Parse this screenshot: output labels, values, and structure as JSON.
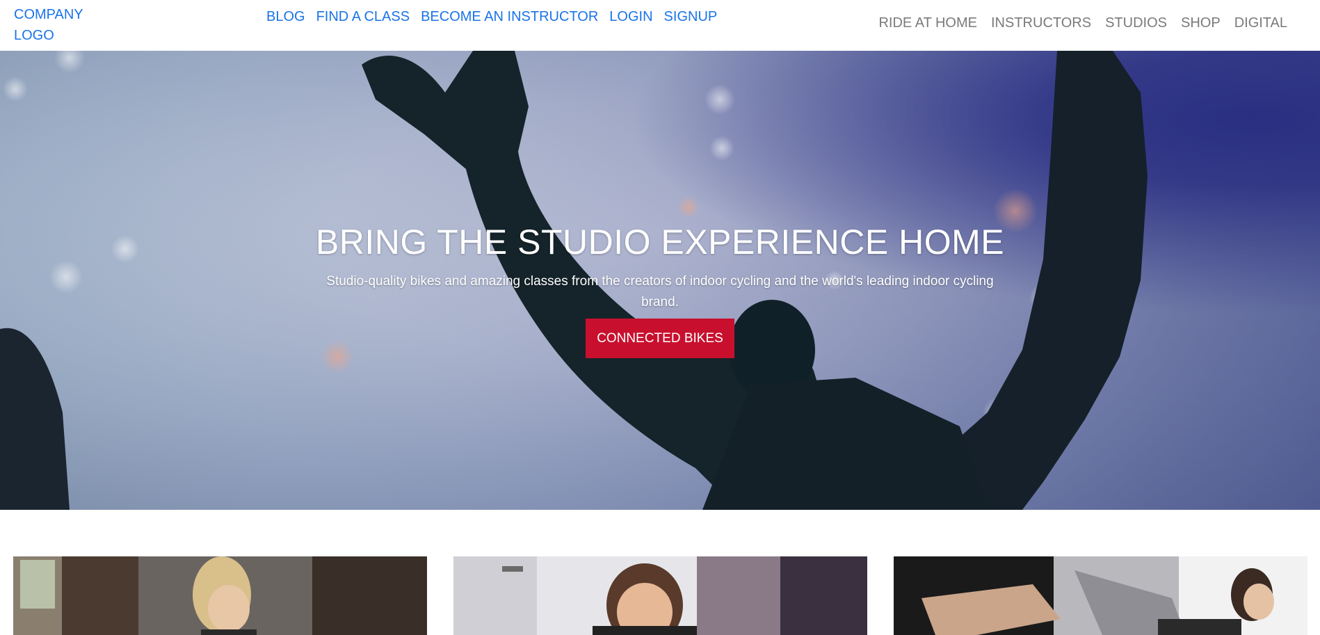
{
  "header": {
    "logo_text": "COMPANY LOGO",
    "primary_nav": [
      "BLOG",
      "FIND A CLASS",
      "BECOME AN INSTRUCTOR",
      "LOGIN",
      "SIGNUP"
    ],
    "secondary_nav": [
      "RIDE AT HOME",
      "INSTRUCTORS",
      "STUDIOS",
      "SHOP",
      "DIGITAL"
    ]
  },
  "hero": {
    "title": "BRING THE STUDIO EXPERIENCE HOME",
    "subtitle": "Studio-quality bikes and amazing classes from the creators of indoor cycling and the world's leading indoor cycling brand.",
    "cta_label": "CONNECTED BIKES"
  },
  "colors": {
    "link_blue": "#1a73e8",
    "nav_gray": "#7a7a7a",
    "cta_red": "#c8102e",
    "hero_accent_purple": "#2b2f8a"
  }
}
